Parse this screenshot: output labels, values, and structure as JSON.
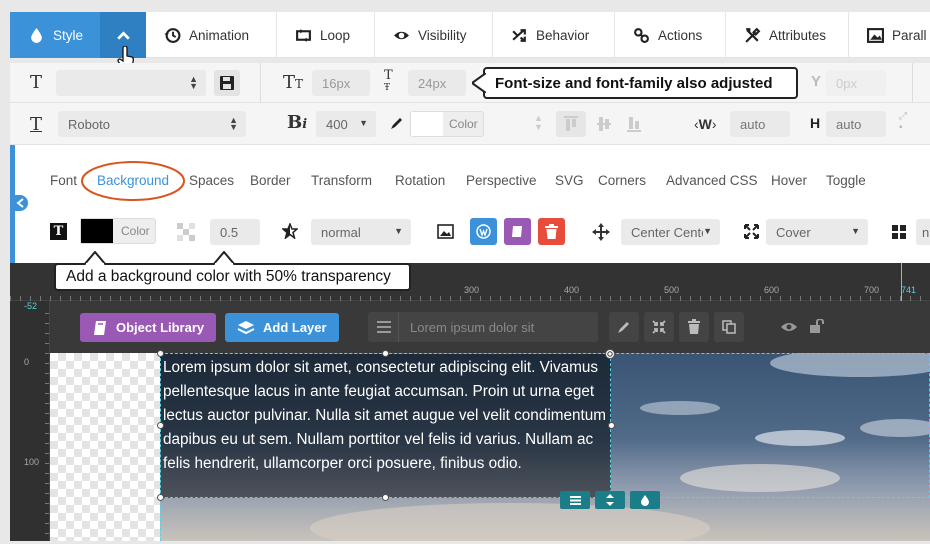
{
  "tabs": [
    {
      "label": "Style",
      "icon": "drop-icon"
    },
    {
      "label": "Animation",
      "icon": "history-icon"
    },
    {
      "label": "Loop",
      "icon": "loop-icon"
    },
    {
      "label": "Visibility",
      "icon": "eye-icon"
    },
    {
      "label": "Behavior",
      "icon": "shuffle-icon"
    },
    {
      "label": "Actions",
      "icon": "link-icon"
    },
    {
      "label": "Attributes",
      "icon": "tools-icon"
    },
    {
      "label": "Parall",
      "icon": "image-icon"
    }
  ],
  "font_row": {
    "font_size": "16px",
    "line_height": "24px",
    "callout": "Font-size and font-family also adjusted",
    "letter_spacing": "0px"
  },
  "font_row2": {
    "font_family": "Roboto",
    "font_weight": "400",
    "color_label": "Color",
    "width_label": "W",
    "width_value": "auto",
    "height_label": "H",
    "height_value": "auto"
  },
  "subtabs": [
    "Font",
    "Background",
    "Spaces",
    "Border",
    "Transform",
    "Rotation",
    "Perspective",
    "SVG",
    "Corners",
    "Advanced CSS",
    "Hover",
    "Toggle"
  ],
  "active_subtab": "Background",
  "bg_row": {
    "color_label": "Color",
    "color_value": "#000000",
    "opacity": "0.5",
    "blend": "normal",
    "position": "Center Center",
    "size": "Cover",
    "callout": "Add a background color with 50% transparency"
  },
  "ruler": {
    "labels": [
      "300",
      "400",
      "500",
      "600",
      "700",
      "741"
    ],
    "vlabels": [
      "-52",
      "0",
      "100"
    ]
  },
  "layer_bar": {
    "object_library": "Object Library",
    "add_layer": "Add Layer",
    "layer_name_placeholder": "Lorem ipsum dolor sit"
  },
  "layer_text": "Lorem ipsum dolor sit amet, consectetur adipiscing elit. Vivamus pellentesque lacus in ante feugiat accumsan. Proin ut urna eget lectus auctor pulvinar. Nulla sit amet augue vel velit condimentum dapibus eu ut sem. Nullam porttitor vel felis id varius. Nullam ac felis hendrerit, ullamcorper orci posuere, finibus odio.",
  "colors": {
    "accent": "#3c92d9",
    "object_library": "#9b59b6",
    "add_layer": "#3c92d9",
    "teal": "#1a7d88",
    "guide": "#56d2e3",
    "callout_circle": "#d9541e"
  }
}
